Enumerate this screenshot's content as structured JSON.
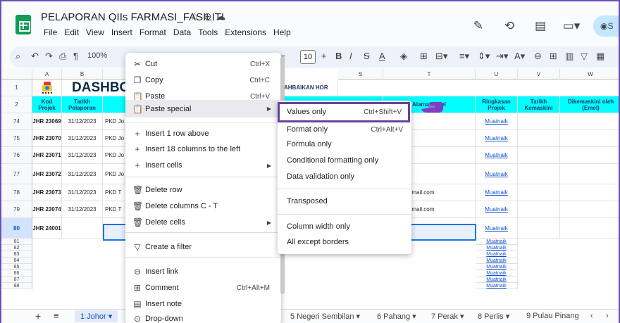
{
  "doc": {
    "title": "PELAPORAN QIIs FARMASI_FASILITI",
    "title_icons": [
      "star-icon",
      "move-icon",
      "cloud-icon"
    ],
    "menu": [
      "File",
      "Edit",
      "View",
      "Insert",
      "Format",
      "Data",
      "Tools",
      "Extensions",
      "Help"
    ],
    "share_label": "S"
  },
  "toolbar": {
    "zoom": "100%",
    "font_size": "10",
    "bold": "B",
    "italic": "I",
    "strike": "S",
    "text_color": "A"
  },
  "columns": [
    "A",
    "B",
    "S",
    "T",
    "U",
    "V",
    "W"
  ],
  "header_rows": {
    "row1_num": "1",
    "row2_num": "2",
    "dashboard_title": "DASHBO",
    "penambaikan": "AHBAIKAN HOR",
    "kod_projek": "Kod Projek",
    "tarikh_pelaporan": "Tarikh Pelaporan",
    "alamat_emel": "Alamat Emel",
    "ringkasan": "Ringkasan Projek",
    "tarikh_kemaskini": "Tarikh Kemaskini",
    "dikemaskini": "Dikemaskini oleh (Emel)"
  },
  "rows": [
    {
      "num": "74",
      "kod": "JHR 23069",
      "tarikh": "31/12/2023",
      "c": "PKD Jo",
      "t": "",
      "u": "Muatnaik"
    },
    {
      "num": "75",
      "kod": "JHR 23070",
      "tarikh": "31/12/2023",
      "c": "PKD Jo",
      "t": "",
      "u": "Muatnaik"
    },
    {
      "num": "76",
      "kod": "JHR 23071",
      "tarikh": "31/12/2023",
      "c": "PKD Jo",
      "t": "",
      "u": "Muatnaik"
    },
    {
      "num": "77",
      "kod": "JHR 23072",
      "tarikh": "31/12/2023",
      "c": "PKD Jo",
      "t": "",
      "u": "Muatnaik"
    },
    {
      "num": "78",
      "kod": "JHR 23073",
      "tarikh": "31/12/2023",
      "c": "PKD T",
      "t": ".sauddi@gmail.com",
      "u": "Muatnaik"
    },
    {
      "num": "79",
      "kod": "JHR 23074",
      "tarikh": "31/12/2023",
      "c": "PKD T",
      "t": ".sauddi@gmail.com",
      "u": "Muatnaik"
    },
    {
      "num": "80",
      "kod": "JHR 24001",
      "tarikh": "",
      "c": "",
      "t": "",
      "u": "Muatnaik"
    }
  ],
  "small_rows": [
    "81",
    "82",
    "83",
    "84",
    "85",
    "86",
    "87",
    "88"
  ],
  "small_link": "Muatnaik",
  "context_menu": {
    "cut": "Cut",
    "cut_sc": "Ctrl+X",
    "copy": "Copy",
    "copy_sc": "Ctrl+C",
    "paste": "Paste",
    "paste_sc": "Ctrl+V",
    "paste_special": "Paste special",
    "insert_row": "Insert 1 row above",
    "insert_cols": "Insert 18 columns to the left",
    "insert_cells": "Insert cells",
    "delete_row": "Delete row",
    "delete_cols": "Delete columns C - T",
    "delete_cells": "Delete cells",
    "create_filter": "Create a filter",
    "insert_link": "Insert link",
    "comment": "Comment",
    "comment_sc": "Ctrl+Alt+M",
    "insert_note": "Insert note",
    "dropdown": "Drop-down"
  },
  "submenu": {
    "values_only": "Values only",
    "values_only_sc": "Ctrl+Shift+V",
    "format_only": "Format only",
    "format_only_sc": "Ctrl+Alt+V",
    "formula_only": "Formula only",
    "conditional": "Conditional formatting only",
    "validation": "Data validation only",
    "transposed": "Transposed",
    "col_width": "Column width only",
    "all_except": "All except borders"
  },
  "tabs": {
    "add": "+",
    "list": "≡",
    "active": "1 Johor ▾",
    "others": [
      "5 Negeri Sembilan ▾",
      "6 Pahang ▾",
      "7 Perak ▾",
      "8 Perlis ▾",
      "9 Pulau Pinang"
    ]
  },
  "colors": {
    "accent": "#6b3fa0",
    "header_cyan": "#00ffff",
    "link": "#1155cc"
  }
}
